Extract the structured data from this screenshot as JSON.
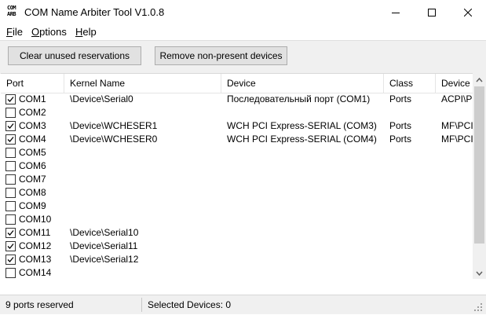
{
  "window": {
    "icon_line1": "COM",
    "icon_line2": "ARB",
    "title": "COM Name Arbiter Tool V1.0.8"
  },
  "menu": {
    "file": "File",
    "options": "Options",
    "help": "Help"
  },
  "toolbar": {
    "clear_label": "Clear unused reservations",
    "remove_label": "Remove non-present devices"
  },
  "table": {
    "columns": [
      "Port",
      "Kernel Name",
      "Device",
      "Class",
      "Device I"
    ],
    "sort_indicator": "^",
    "rows": [
      {
        "checked": true,
        "port": "COM1",
        "kernel": "\\Device\\Serial0",
        "device": "Последовательный порт (COM1)",
        "class": "Ports",
        "devid": "ACPI\\PN"
      },
      {
        "checked": false,
        "port": "COM2",
        "kernel": "",
        "device": "",
        "class": "",
        "devid": ""
      },
      {
        "checked": true,
        "port": "COM3",
        "kernel": "\\Device\\WCHESER1",
        "device": "WCH PCI Express-SERIAL (COM3)",
        "class": "Ports",
        "devid": "MF\\PCI\\"
      },
      {
        "checked": true,
        "port": "COM4",
        "kernel": "\\Device\\WCHESER0",
        "device": "WCH PCI Express-SERIAL (COM4)",
        "class": "Ports",
        "devid": "MF\\PCI\\"
      },
      {
        "checked": false,
        "port": "COM5",
        "kernel": "",
        "device": "",
        "class": "",
        "devid": ""
      },
      {
        "checked": false,
        "port": "COM6",
        "kernel": "",
        "device": "",
        "class": "",
        "devid": ""
      },
      {
        "checked": false,
        "port": "COM7",
        "kernel": "",
        "device": "",
        "class": "",
        "devid": ""
      },
      {
        "checked": false,
        "port": "COM8",
        "kernel": "",
        "device": "",
        "class": "",
        "devid": ""
      },
      {
        "checked": false,
        "port": "COM9",
        "kernel": "",
        "device": "",
        "class": "",
        "devid": ""
      },
      {
        "checked": false,
        "port": "COM10",
        "kernel": "",
        "device": "",
        "class": "",
        "devid": ""
      },
      {
        "checked": true,
        "port": "COM11",
        "kernel": "\\Device\\Serial10",
        "device": "",
        "class": "",
        "devid": ""
      },
      {
        "checked": true,
        "port": "COM12",
        "kernel": "\\Device\\Serial11",
        "device": "",
        "class": "",
        "devid": ""
      },
      {
        "checked": true,
        "port": "COM13",
        "kernel": "\\Device\\Serial12",
        "device": "",
        "class": "",
        "devid": ""
      },
      {
        "checked": false,
        "port": "COM14",
        "kernel": "",
        "device": "",
        "class": "",
        "devid": ""
      }
    ]
  },
  "status": {
    "reserved": "9 ports reserved",
    "selected": "Selected Devices: 0"
  }
}
